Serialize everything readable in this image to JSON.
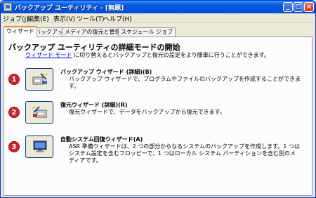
{
  "window": {
    "title": "バックアップ ユーティリティ - [無題]"
  },
  "menu": [
    "ジョブ(J)",
    "編集(E)",
    "表示(V)",
    "ツール(T)",
    "ヘルプ(H)"
  ],
  "tabs": [
    "ウィザード",
    "バックアップ",
    "メディアの復元と管理",
    "スケジュール ジョブ"
  ],
  "main": {
    "heading": "バックアップ ユーティリティの詳細モードの開始",
    "desc_link": "ウィザード モード",
    "desc_rest": " に切り替えるとバックアップと復元の設定をより簡単に行うことができます。"
  },
  "wizards": [
    {
      "badge": "1",
      "title": "バックアップ ウィザード (詳細)(B)",
      "desc": "バックアップ ウィザードで、プログラムやファイルのバックアップを作成することができます。",
      "icon": "backup-wizard-icon"
    },
    {
      "badge": "2",
      "title": "復元ウィザード (詳細)(R)",
      "desc": "復元ウィザードで、データをバックアップから復元できます。",
      "icon": "restore-wizard-icon"
    },
    {
      "badge": "3",
      "title": "自動システム回復ウィザード(A)",
      "desc": "ASR 準備ウィザードは、2 つの部分からなるシステムのバックアップを作成します。1 つはシステム設定を含むフロッピーで、1 つはローカル システム パーティションを含む別のメディアです。",
      "icon": "asr-wizard-icon"
    }
  ],
  "colors": {
    "badge": "#d2242b",
    "titlebar": "#0055e5",
    "link": "#0000ee"
  }
}
